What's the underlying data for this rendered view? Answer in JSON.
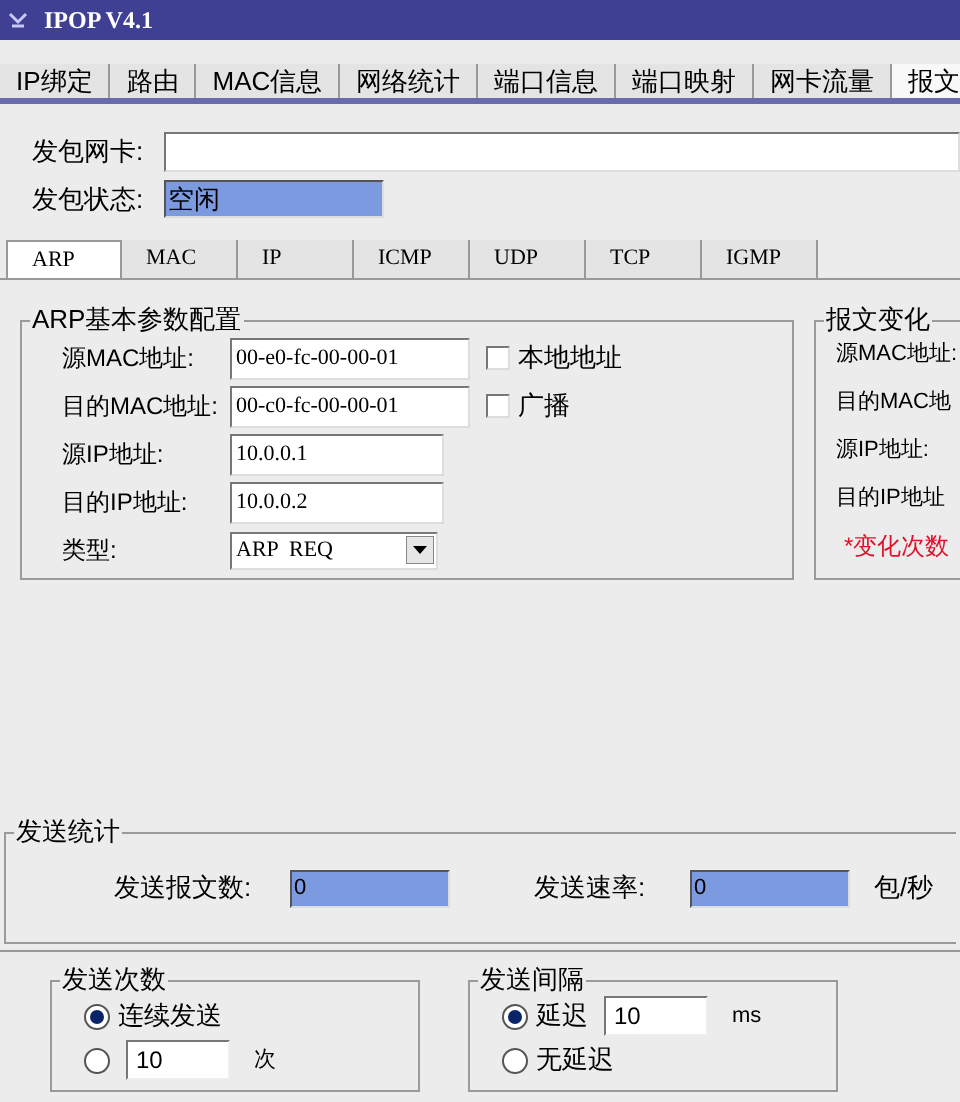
{
  "window": {
    "title": "IPOP V4.1"
  },
  "main_tabs": [
    {
      "label": "IP绑定",
      "selected": false
    },
    {
      "label": "路由",
      "selected": false
    },
    {
      "label": "MAC信息",
      "selected": false
    },
    {
      "label": "网络统计",
      "selected": false
    },
    {
      "label": "端口信息",
      "selected": false
    },
    {
      "label": "端口映射",
      "selected": false
    },
    {
      "label": "网卡流量",
      "selected": false
    },
    {
      "label": "报文",
      "selected": true
    }
  ],
  "nic": {
    "label": "发包网卡:"
  },
  "status": {
    "label": "发包状态:",
    "value": "空闲"
  },
  "protocol_tabs": [
    {
      "label": "ARP",
      "selected": true
    },
    {
      "label": "MAC",
      "selected": false
    },
    {
      "label": "IP",
      "selected": false
    },
    {
      "label": "ICMP",
      "selected": false
    },
    {
      "label": "UDP",
      "selected": false
    },
    {
      "label": "TCP",
      "selected": false
    },
    {
      "label": "IGMP",
      "selected": false
    }
  ],
  "arp_config": {
    "title": "ARP基本参数配置",
    "fields": [
      {
        "kind": "text",
        "label": "源MAC地址:",
        "value": "00-e0-fc-00-00-01",
        "checkbox": {
          "label": "本地地址",
          "checked": false
        }
      },
      {
        "kind": "text",
        "label": "目的MAC地址:",
        "value": "00-c0-fc-00-00-01",
        "checkbox": {
          "label": "广播",
          "checked": false
        }
      },
      {
        "kind": "text",
        "label": "源IP地址:",
        "value": "10.0.0.1"
      },
      {
        "kind": "text",
        "label": "目的IP地址:",
        "value": "10.0.0.2"
      },
      {
        "kind": "select",
        "label": "类型:",
        "value": "ARP  REQ"
      }
    ]
  },
  "change_panel": {
    "title": "报文变化",
    "labels": [
      "源MAC地址:",
      "目的MAC地",
      "源IP地址:",
      "目的IP地址"
    ],
    "note": "*变化次数"
  },
  "stats": {
    "title": "发送统计",
    "count_label": "发送报文数:",
    "count_value": "0",
    "rate_label": "发送速率:",
    "rate_value": "0",
    "unit": "包/秒"
  },
  "send_count": {
    "title": "发送次数",
    "options": [
      {
        "label": "连续发送",
        "selected": true
      },
      {
        "value": "10",
        "unit": "次",
        "selected": false
      }
    ]
  },
  "send_interval": {
    "title": "发送间隔",
    "options": [
      {
        "label": "延迟",
        "value": "10",
        "unit": "ms",
        "selected": true
      },
      {
        "label": "无延迟",
        "selected": false
      }
    ]
  }
}
